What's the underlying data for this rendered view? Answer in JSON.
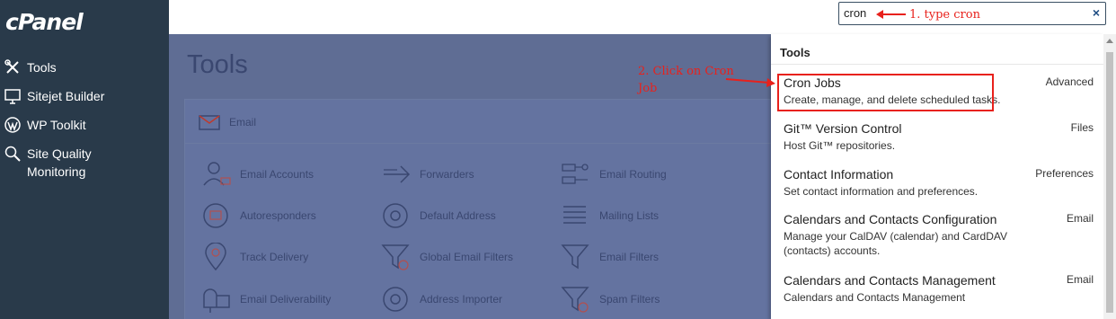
{
  "brand": {
    "logo": "cPanel"
  },
  "sidebar": {
    "items": [
      {
        "label": "Tools",
        "icon": "tools-icon"
      },
      {
        "label": "Sitejet Builder",
        "icon": "monitor-icon"
      },
      {
        "label": "WP Toolkit",
        "icon": "wordpress-icon"
      },
      {
        "label": "Site Quality Monitoring",
        "icon": "magnifier-icon"
      }
    ]
  },
  "search": {
    "value": "cron",
    "clear_label": "×"
  },
  "annotations": {
    "step1": "1. type cron",
    "step2": "2. Click on Cron Job"
  },
  "main": {
    "page_title": "Tools",
    "section_title": "Email",
    "tools": [
      "Email Accounts",
      "Forwarders",
      "Email Routing",
      "Autoresponders",
      "Default Address",
      "Mailing Lists",
      "Track Delivery",
      "Global Email Filters",
      "Email Filters",
      "Email Deliverability",
      "Address Importer",
      "Spam Filters"
    ]
  },
  "dropdown": {
    "title": "Tools",
    "results": [
      {
        "title": "Cron Jobs",
        "desc": "Create, manage, and delete scheduled tasks.",
        "category": "Advanced"
      },
      {
        "title": "Git™ Version Control",
        "desc": "Host Git™ repositories.",
        "category": "Files"
      },
      {
        "title": "Contact Information",
        "desc": "Set contact information and preferences.",
        "category": "Preferences"
      },
      {
        "title": "Calendars and Contacts Configuration",
        "desc": "Manage your CalDAV (calendar) and CardDAV (contacts) accounts.",
        "category": "Email"
      },
      {
        "title": "Calendars and Contacts Management",
        "desc": "Calendars and Contacts Management",
        "category": "Email"
      }
    ]
  },
  "colors": {
    "sidebar": "#293a4a",
    "overlay": "#5f6d94",
    "annotation": "#e8211c",
    "search_border": "#3a4f63"
  }
}
